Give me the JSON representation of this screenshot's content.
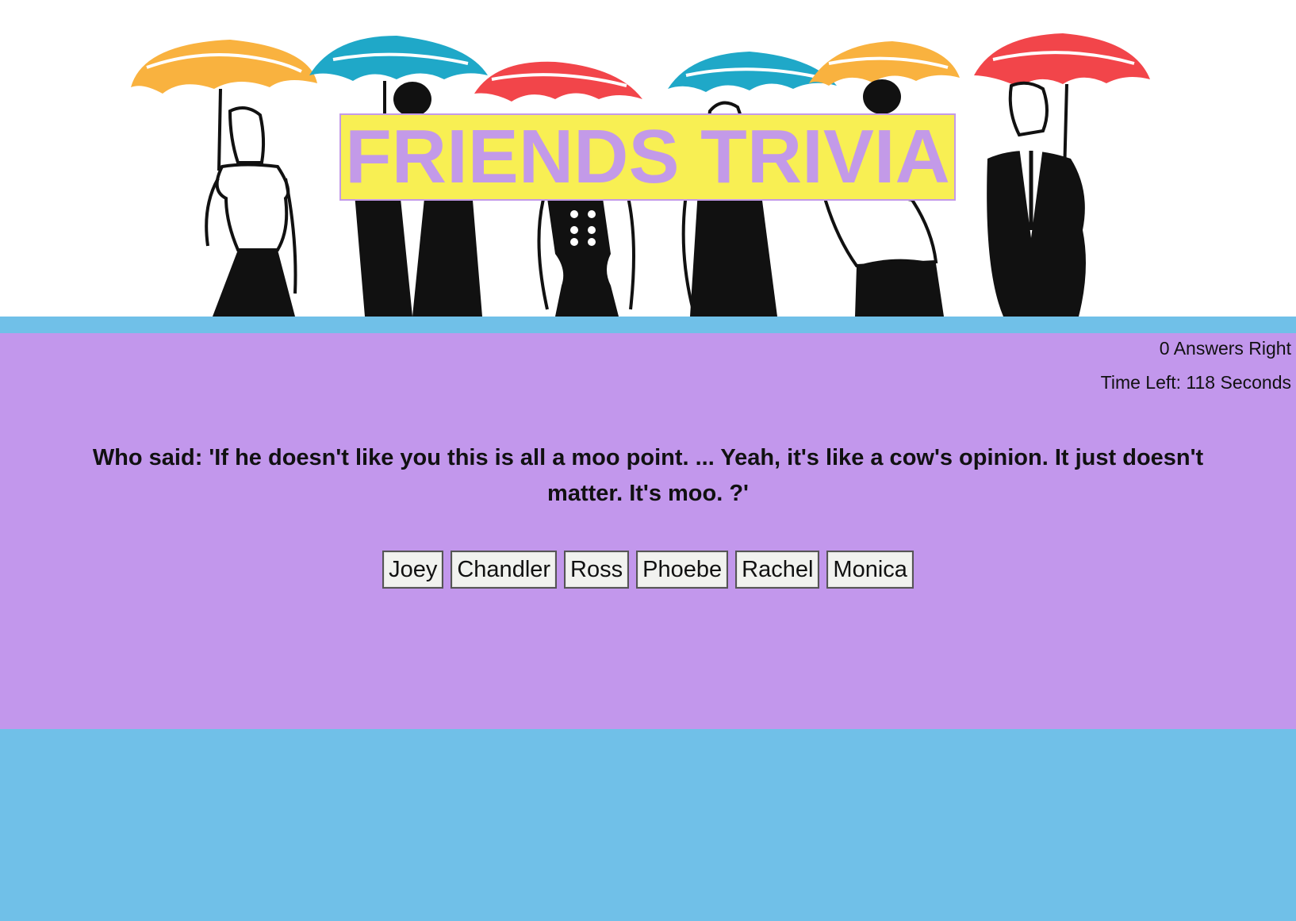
{
  "header": {
    "title": "FRIENDS TRIVIA"
  },
  "status": {
    "score": "0 Answers Right",
    "timer": "Time Left: 118 Seconds"
  },
  "quiz": {
    "question": "Who said: 'If he doesn't like you this is all a moo point. ... Yeah, it's like a cow's opinion. It just doesn't matter. It's moo. ?'",
    "answers": [
      "Joey",
      "Chandler",
      "Ross",
      "Phoebe",
      "Rachel",
      "Monica"
    ]
  },
  "colors": {
    "background_blue": "#70c0e8",
    "panel_purple": "#c297ec",
    "title_yellow": "#f8ef53",
    "title_purple": "#c39ae8",
    "umbrella_orange": "#f9b23f",
    "umbrella_teal": "#1fa8c8",
    "umbrella_red": "#f2454a"
  },
  "banner_icons": [
    "umbrella-orange-icon",
    "umbrella-teal-icon",
    "umbrella-red-icon",
    "umbrella-teal-icon",
    "umbrella-orange-icon",
    "umbrella-red-icon"
  ]
}
